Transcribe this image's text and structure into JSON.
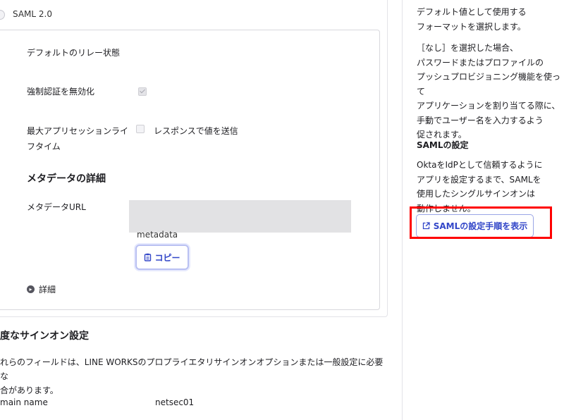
{
  "saml": {
    "option_label": "SAML 2.0"
  },
  "fields": {
    "default_relay_state": "デフォルトのリレー状態",
    "disable_force_auth": "強制認証を無効化",
    "max_session_lifetime_line1": "最大アプリセッションライ",
    "max_session_lifetime_line2": "フタイム",
    "send_in_response": "レスポンスで値を送信"
  },
  "metadata": {
    "section_title": "メタデータの詳細",
    "url_label": "メタデータURL",
    "metadata_text": "metadata",
    "copy_label": "コピー",
    "details_label": "詳細"
  },
  "advanced": {
    "title": "度なサインオン設定",
    "desc_line1": "れらのフィールドは、LINE WORKSのプロプライエタリサインオンオプションまたは一般設定に必要な",
    "desc_line2": "合があります。",
    "domain_label": "main name",
    "domain_value": "netsec01"
  },
  "sidebar": {
    "text_top_line1": "デフォルト値として使用する",
    "text_top_line2": "フォーマットを選択します。",
    "none_line1": "［なし］を選択した場合、",
    "none_line2": "パスワードまたはプロファイルの",
    "none_line3": "プッシュプロビジョニング機能を使って",
    "none_line4": "アプリケーションを割り当てる際に、",
    "none_line5": "手動でユーザー名を入力するよう",
    "none_line6": "促されます。",
    "saml_title": "SAMLの設定",
    "saml_line1": "OktaをIdPとして信頼するように",
    "saml_line2": "アプリを設定するまで、SAMLを",
    "saml_line3": "使用したシングルサインオンは",
    "saml_line4": "動作しません。",
    "saml_button": "SAMLの設定手順を表示"
  },
  "colors": {
    "accent": "#3246c8",
    "highlight": "#ff0000"
  },
  "icons": {
    "copy": "clipboard-icon",
    "external": "external-link-icon",
    "details": "chevron-right-icon"
  }
}
